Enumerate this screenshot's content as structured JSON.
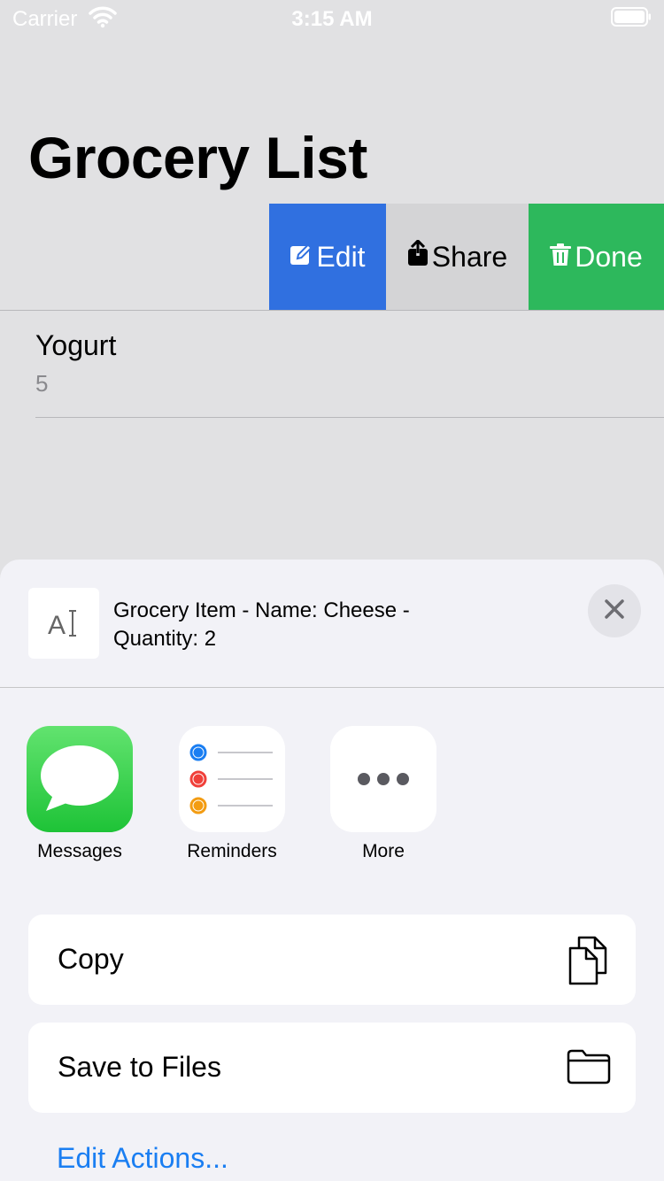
{
  "status_bar": {
    "carrier": "Carrier",
    "time": "3:15 AM"
  },
  "page": {
    "title": "Grocery List"
  },
  "swipe_actions": {
    "edit": "Edit",
    "share": "Share",
    "done": "Done"
  },
  "list": {
    "items": [
      {
        "name": "Yogurt",
        "quantity": "5"
      }
    ]
  },
  "share_sheet": {
    "preview_text": "Grocery Item - Name: Cheese - Quantity: 2",
    "apps": [
      {
        "label": "Messages",
        "icon": "messages-icon"
      },
      {
        "label": "Reminders",
        "icon": "reminders-icon"
      },
      {
        "label": "More",
        "icon": "more-icon"
      }
    ],
    "actions": [
      {
        "label": "Copy",
        "icon": "copy-icon"
      },
      {
        "label": "Save to Files",
        "icon": "folder-icon"
      }
    ],
    "edit_actions_label": "Edit Actions..."
  },
  "colors": {
    "edit": "#3070e0",
    "share": "#d4d4d6",
    "done": "#2db85c",
    "link": "#1a7ef2"
  }
}
